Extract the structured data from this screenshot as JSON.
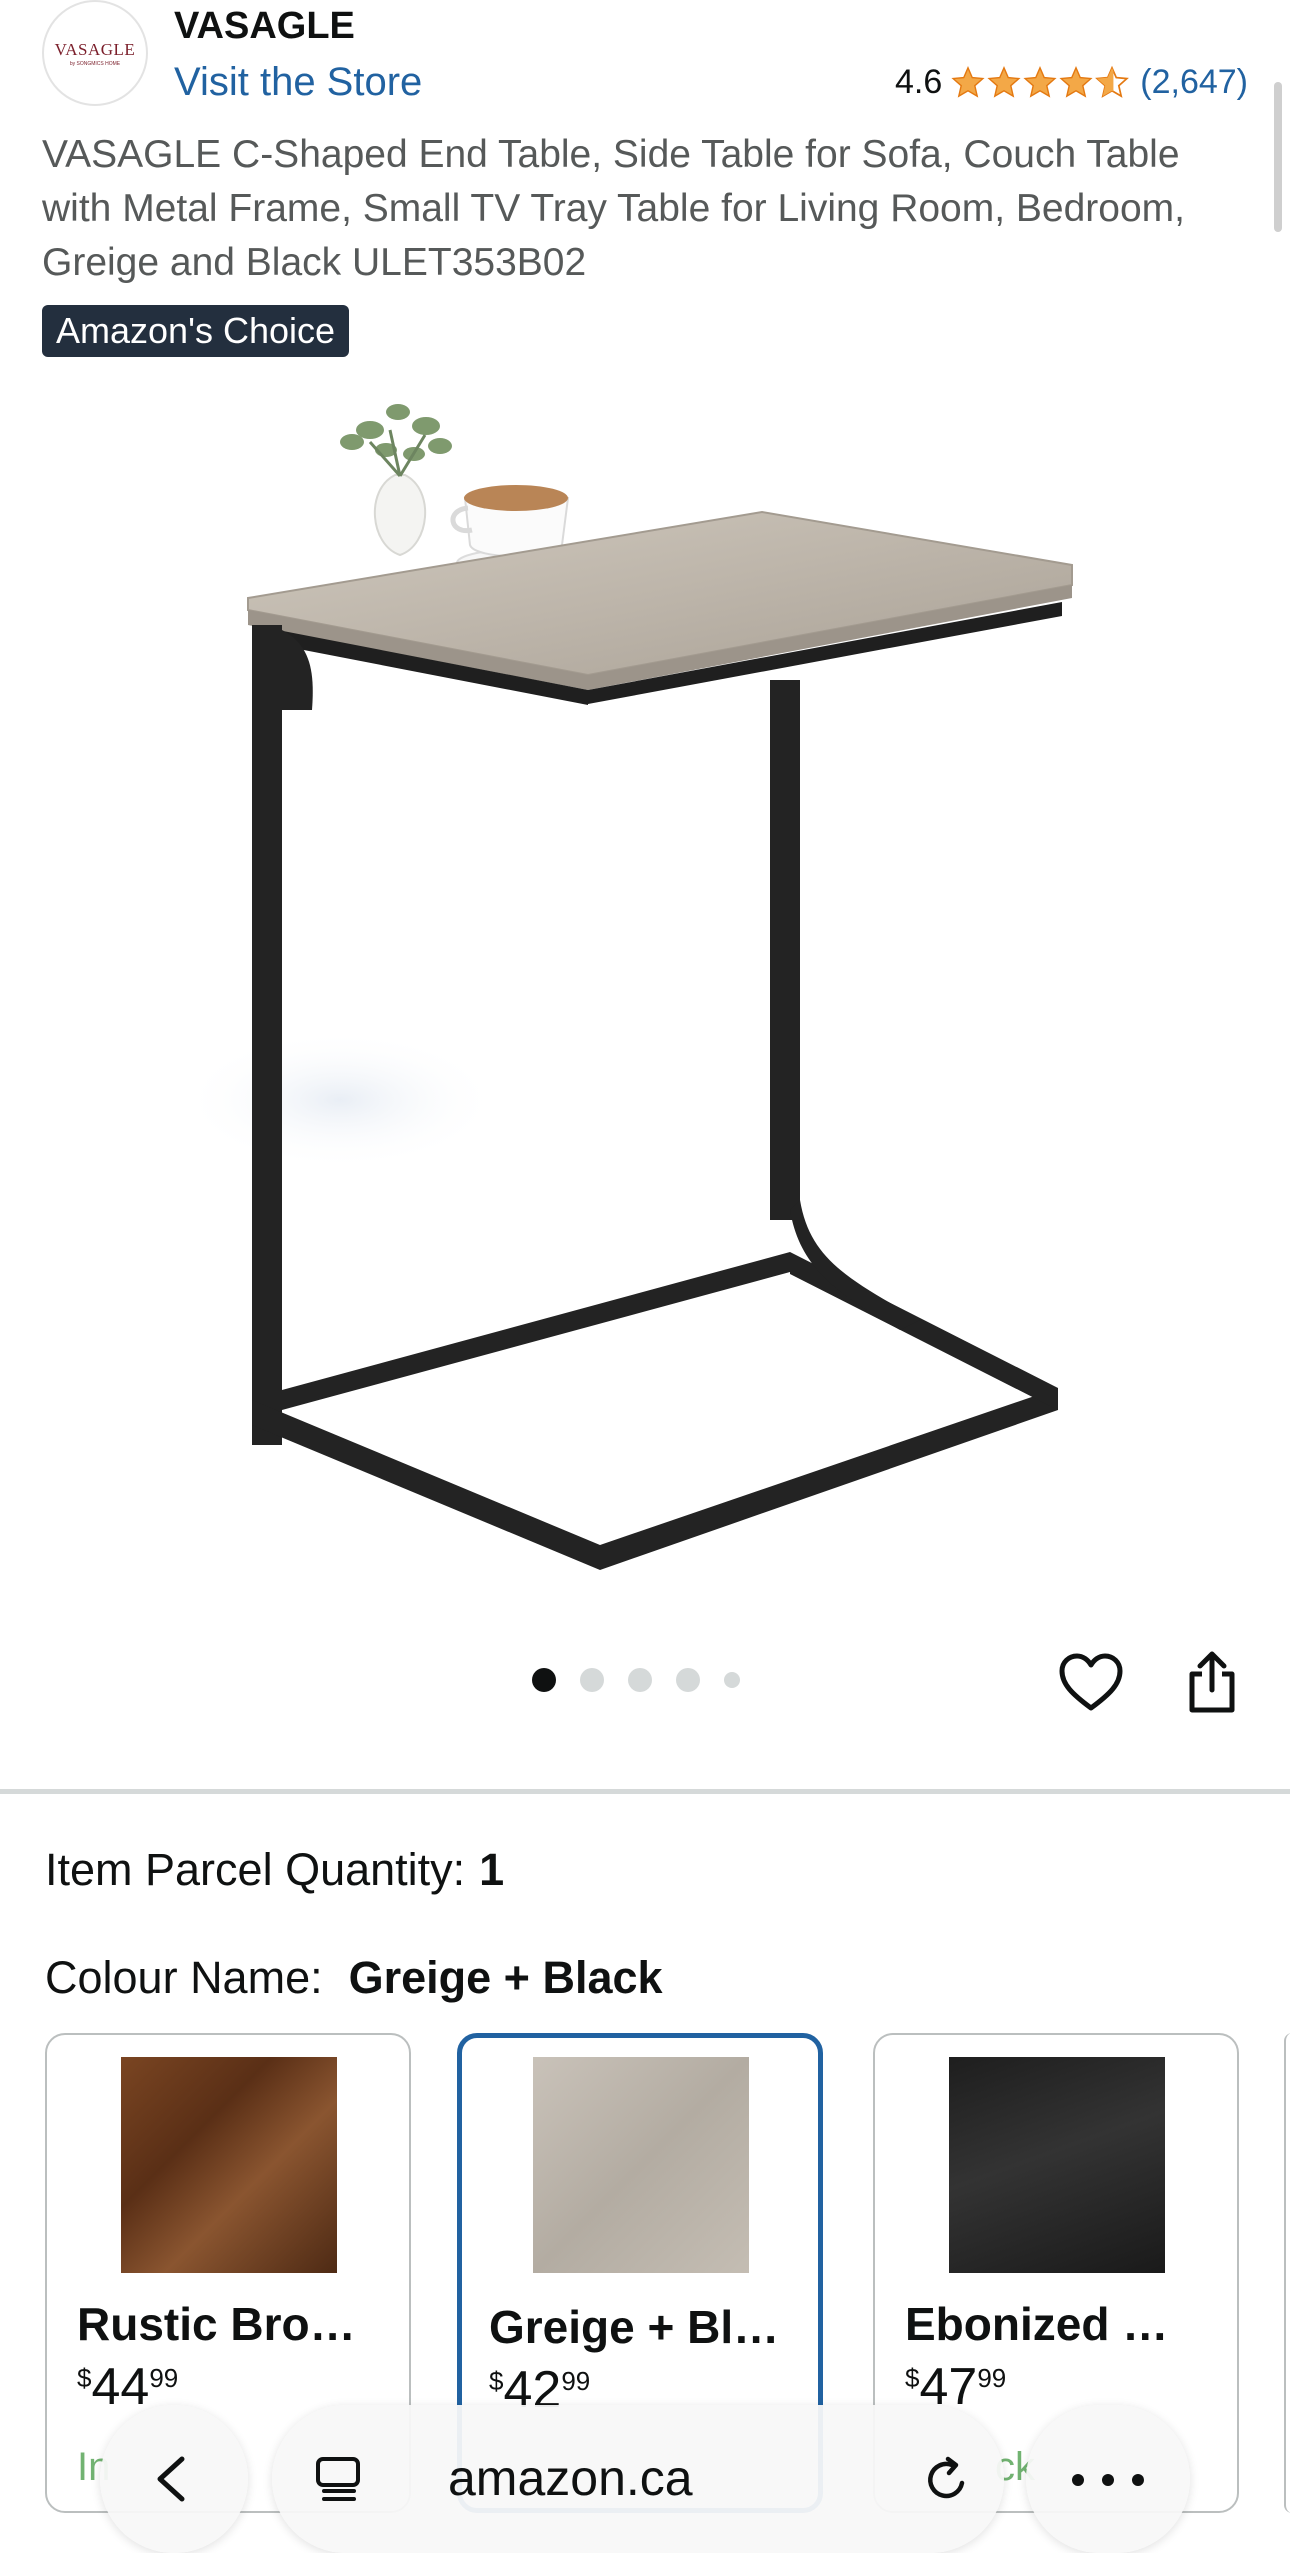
{
  "header": {
    "logo_text": "VASAGLE",
    "logo_subtext": "by SONGMICS HOME",
    "brand": "VASAGLE",
    "visit_store": "Visit the Store",
    "rating": "4.6",
    "rating_count": "(2,647)",
    "star_color": "#f3a847"
  },
  "product": {
    "title": "VASAGLE C-Shaped End Table, Side Table for Sofa, Couch Table with Metal Frame, Small TV Tray Table for Living Room, Bedroom, Greige and Black ULET353B02",
    "badge": "Amazon's Choice",
    "image_icon": "side-table-product-image",
    "image_count": 5,
    "active_image_index": 0
  },
  "actions": {
    "wishlist_icon": "heart-icon",
    "share_icon": "share-icon"
  },
  "options": {
    "quantity_label": "Item Parcel Quantity:",
    "quantity_value": "1",
    "colour_label": "Colour Name:",
    "colour_value": "Greige + Black"
  },
  "swatches": [
    {
      "name": "Rustic Bro…",
      "price_symbol": "$",
      "price_whole": "44",
      "price_fraction": "99",
      "stock": "In",
      "color": "#6b3a1e",
      "selected": false
    },
    {
      "name": "Greige + Bl…",
      "price_symbol": "$",
      "price_whole": "42",
      "price_fraction": "99",
      "stock": "",
      "color": "#bdb6ad",
      "selected": true
    },
    {
      "name": "Ebonized …",
      "price_symbol": "$",
      "price_whole": "47",
      "price_fraction": "99",
      "stock": "ck",
      "color": "#262626",
      "selected": false
    }
  ],
  "browser": {
    "url": "amazon.ca",
    "back_icon": "chevron-left-icon",
    "tabs_icon": "tabs-icon",
    "reload_icon": "reload-icon",
    "more_icon": "more-icon"
  }
}
